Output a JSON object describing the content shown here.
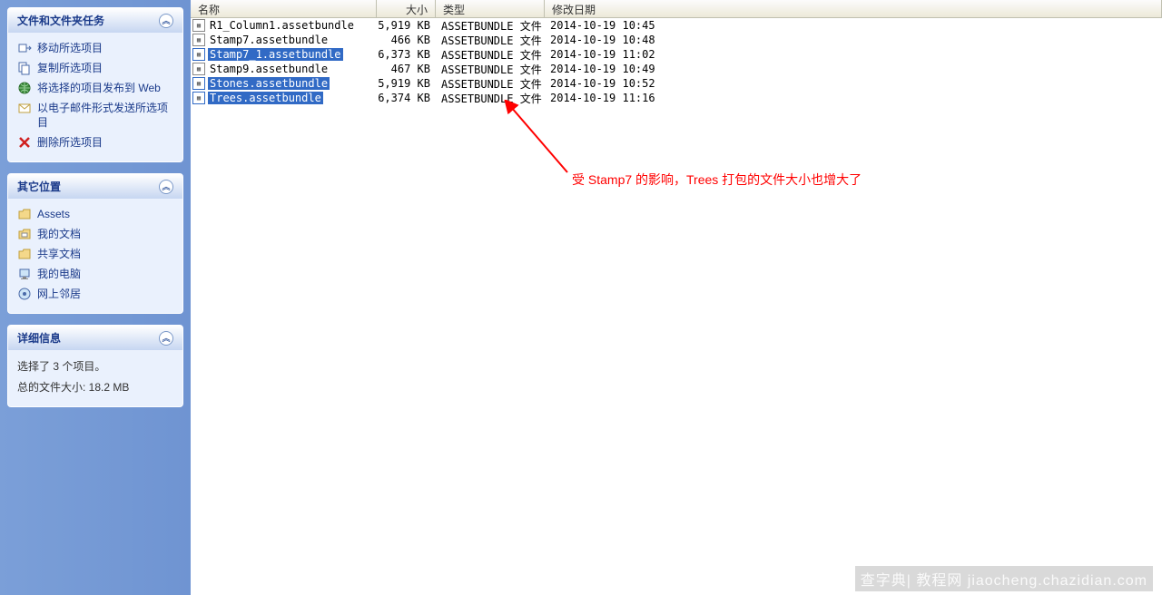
{
  "sidebar": {
    "tasks_panel": {
      "title": "文件和文件夹任务",
      "items": [
        {
          "icon": "move",
          "label": "移动所选项目"
        },
        {
          "icon": "copy",
          "label": "复制所选项目"
        },
        {
          "icon": "web",
          "label": "将选择的项目发布到 Web"
        },
        {
          "icon": "mail",
          "label": "以电子邮件形式发送所选项目"
        },
        {
          "icon": "del",
          "label": "删除所选项目"
        }
      ]
    },
    "places_panel": {
      "title": "其它位置",
      "items": [
        {
          "icon": "folder",
          "label": "Assets"
        },
        {
          "icon": "doc",
          "label": "我的文档"
        },
        {
          "icon": "folder",
          "label": "共享文档"
        },
        {
          "icon": "comp",
          "label": "我的电脑"
        },
        {
          "icon": "net",
          "label": "网上邻居"
        }
      ]
    },
    "details_panel": {
      "title": "详细信息",
      "line1": "选择了 3 个项目。",
      "line2": "总的文件大小: 18.2 MB"
    }
  },
  "columns": {
    "name": "名称",
    "size": "大小",
    "type": "类型",
    "date": "修改日期"
  },
  "files": [
    {
      "name": "R1_Column1.assetbundle",
      "size": "5,919 KB",
      "type": "ASSETBUNDLE 文件",
      "date": "2014-10-19 10:45",
      "selected": false
    },
    {
      "name": "Stamp7.assetbundle",
      "size": "466 KB",
      "type": "ASSETBUNDLE 文件",
      "date": "2014-10-19 10:48",
      "selected": false
    },
    {
      "name": "Stamp7_1.assetbundle",
      "size": "6,373 KB",
      "type": "ASSETBUNDLE 文件",
      "date": "2014-10-19 11:02",
      "selected": true
    },
    {
      "name": "Stamp9.assetbundle",
      "size": "467 KB",
      "type": "ASSETBUNDLE 文件",
      "date": "2014-10-19 10:49",
      "selected": false
    },
    {
      "name": "Stones.assetbundle",
      "size": "5,919 KB",
      "type": "ASSETBUNDLE 文件",
      "date": "2014-10-19 10:52",
      "selected": true
    },
    {
      "name": "Trees.assetbundle",
      "size": "6,374 KB",
      "type": "ASSETBUNDLE 文件",
      "date": "2014-10-19 11:16",
      "selected": true
    }
  ],
  "annotation": "受 Stamp7 的影响，Trees 打包的文件大小也增大了",
  "watermark": "查字典| 教程网  jiaocheng.chazidian.com"
}
